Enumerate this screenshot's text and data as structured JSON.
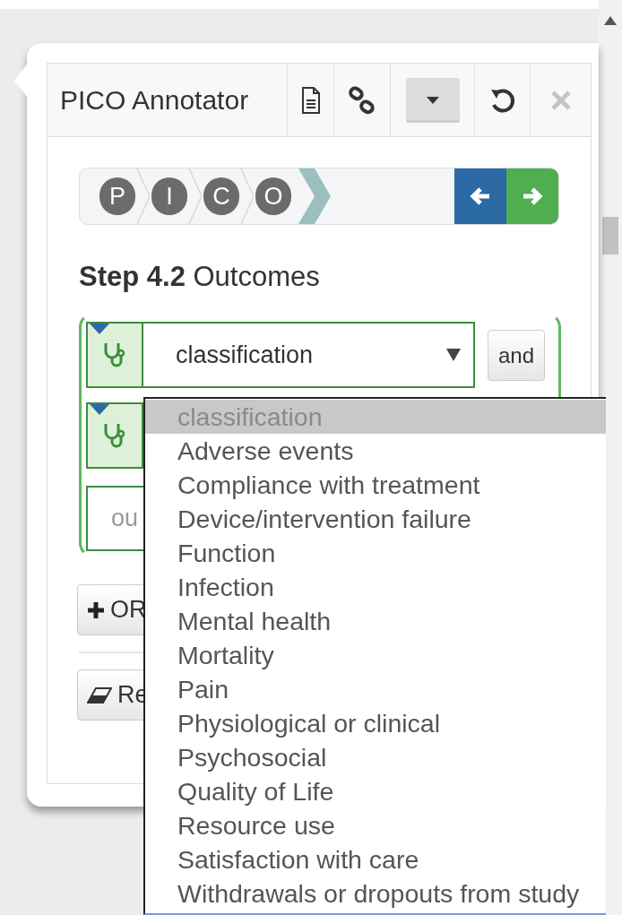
{
  "panel": {
    "title": "PICO Annotator",
    "tools": [
      {
        "kind": "document",
        "active": false,
        "disabled": false
      },
      {
        "kind": "link",
        "active": false,
        "disabled": false
      },
      {
        "kind": "caret",
        "active": true,
        "disabled": false
      },
      {
        "kind": "undo",
        "active": false,
        "disabled": false
      },
      {
        "kind": "close",
        "active": false,
        "disabled": true
      }
    ]
  },
  "stepper": {
    "steps": [
      {
        "label": "P"
      },
      {
        "label": "I"
      },
      {
        "label": "C"
      },
      {
        "label": "O"
      }
    ],
    "nav": [
      {
        "kind": "back"
      },
      {
        "kind": "forward"
      }
    ]
  },
  "heading": "**Step 4.2** Outcomes",
  "group": {
    "rows": [
      {
        "kind": "select",
        "value": "classification",
        "button": "and"
      },
      {
        "kind": "select"
      },
      {
        "kind": "text",
        "placeholder": "ou"
      }
    ]
  },
  "actions": [
    {
      "kind": "add",
      "label": "OR"
    },
    {
      "kind": "reset",
      "label": "Re"
    }
  ],
  "dropdown": {
    "options": [
      {
        "label": "classification",
        "selected": true,
        "disabled": true
      },
      {
        "label": "Adverse events",
        "selected": false,
        "disabled": false
      },
      {
        "label": "Compliance with treatment",
        "selected": false,
        "disabled": false
      },
      {
        "label": "Device/intervention failure",
        "selected": false,
        "disabled": false
      },
      {
        "label": "Function",
        "selected": false,
        "disabled": false
      },
      {
        "label": "Infection",
        "selected": false,
        "disabled": false
      },
      {
        "label": "Mental health",
        "selected": false,
        "disabled": false
      },
      {
        "label": "Mortality",
        "selected": false,
        "disabled": false
      },
      {
        "label": "Pain",
        "selected": false,
        "disabled": false
      },
      {
        "label": "Physiological or clinical",
        "selected": false,
        "disabled": false
      },
      {
        "label": "Psychosocial",
        "selected": false,
        "disabled": false
      },
      {
        "label": "Quality of Life",
        "selected": false,
        "disabled": false
      },
      {
        "label": "Resource use",
        "selected": false,
        "disabled": false
      },
      {
        "label": "Satisfaction with care",
        "selected": false,
        "disabled": false
      },
      {
        "label": "Withdrawals or dropouts from study",
        "selected": false,
        "disabled": false
      }
    ]
  }
}
